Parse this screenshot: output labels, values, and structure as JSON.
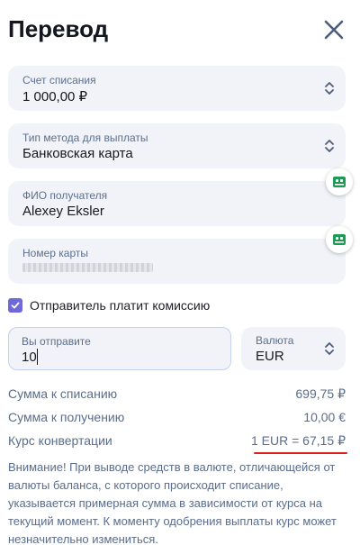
{
  "header": {
    "title": "Перевод"
  },
  "debit_account": {
    "label": "Счет списания",
    "value": "1 000,00 ₽"
  },
  "payout_method": {
    "label": "Тип метода для выплаты",
    "value": "Банковская карта"
  },
  "recipient": {
    "label": "ФИО получателя",
    "value": "Alexey Eksler"
  },
  "card_number": {
    "label": "Номер карты"
  },
  "commission": {
    "label": "Отправитель платит комиссию",
    "checked": true
  },
  "send": {
    "label": "Вы отправите",
    "value": "10"
  },
  "currency": {
    "label": "Валюта",
    "value": "EUR"
  },
  "summary": {
    "debit_label": "Сумма к списанию",
    "debit_value": "699,75 ₽",
    "receive_label": "Сумма к получению",
    "receive_value": "10,00 €",
    "rate_label": "Курс конвертации",
    "rate_value": "1 EUR = 67,15 ₽"
  },
  "warning": "Внимание! При выводе средств в валюте, отличающейся от валюты баланса, с которого происходит списание, указывается примерная сумма в зависимости от курса на текущий момент. К моменту одобрения выплаты курс может незначительно измениться.",
  "colors": {
    "accent": "#6f68d8",
    "field_bg": "#f1f3f8",
    "muted_text": "#5a6d8c",
    "highlight_underline": "#e01e1e",
    "icon_green": "#1e9a55"
  },
  "icons": {
    "close": "close-icon",
    "stepper": "chevron-up-down-icon",
    "scan": "card-scan-icon",
    "check": "check-icon"
  }
}
